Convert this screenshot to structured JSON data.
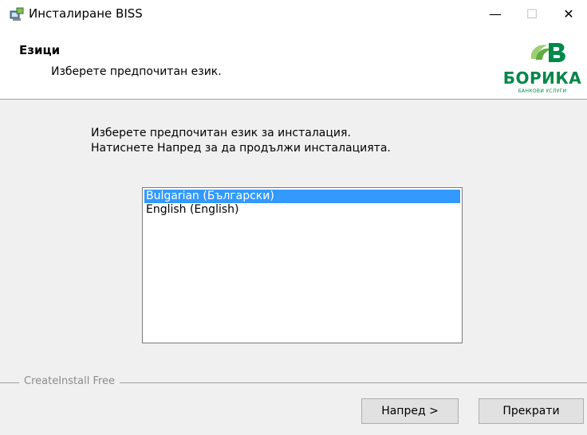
{
  "window": {
    "title": "Инсталиране BISS",
    "controls": {
      "minimize": "—",
      "maximize": "☐",
      "close": "✕"
    }
  },
  "header": {
    "title": "Езици",
    "subtitle": "Изберете предпочитан език.",
    "logo": {
      "name": "БОРИКА",
      "tagline": "БАНКОВИ УСЛУГИ",
      "icon": "borica-logo-icon",
      "color": "#00884a"
    }
  },
  "instructions": {
    "line1": "Изберете предпочитан език за инсталация.",
    "line2": "Натиснете Напред за да продължи инсталацията."
  },
  "languages": [
    {
      "label": "Bulgarian (Български)",
      "selected": true
    },
    {
      "label": "English (English)",
      "selected": false
    }
  ],
  "footer": {
    "brand": "CreateInstall Free",
    "next_label": "Напред >",
    "cancel_label": "Прекрати"
  },
  "colors": {
    "selection": "#3399ff",
    "dialog_bg": "#f0f0f0"
  }
}
